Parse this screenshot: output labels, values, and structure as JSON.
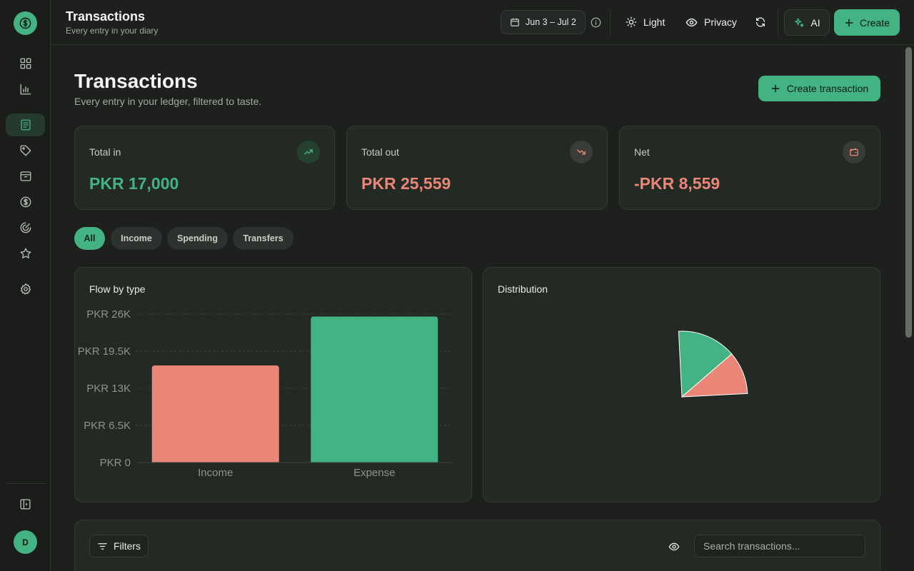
{
  "colors": {
    "accent": "#43b383",
    "income": "#43b383",
    "expense": "#ea8677",
    "bar_income": "#ea8677",
    "bar_expense": "#43b383"
  },
  "sidebar": {
    "logo_icon": "dollar-icon",
    "items": [
      {
        "name": "dashboard",
        "icon": "grid-icon",
        "active": false
      },
      {
        "name": "reports",
        "icon": "bar-chart-icon",
        "active": false
      },
      {
        "name": "transactions",
        "icon": "receipt-icon",
        "active": true
      },
      {
        "name": "categories",
        "icon": "tag-icon",
        "active": false
      },
      {
        "name": "accounts",
        "icon": "inbox-icon",
        "active": false
      },
      {
        "name": "budgets",
        "icon": "dollar-circle-icon",
        "active": false
      },
      {
        "name": "goals",
        "icon": "target-icon",
        "active": false
      },
      {
        "name": "favorites",
        "icon": "star-icon",
        "active": false
      },
      {
        "name": "settings",
        "icon": "gear-icon",
        "active": false
      }
    ],
    "avatar_initial": "D"
  },
  "topbar": {
    "title": "Transactions",
    "subtitle": "Every entry in your diary",
    "date_range": "Jun 3 – Jul 2",
    "theme_label": "Light",
    "privacy_label": "Privacy",
    "ai_label": "AI",
    "create_label": "Create"
  },
  "page": {
    "title": "Transactions",
    "subtitle": "Every entry in your ledger, filtered to taste.",
    "create_button": "Create transaction"
  },
  "stats": {
    "total_in": {
      "label": "Total in",
      "value": "PKR 17,000"
    },
    "total_out": {
      "label": "Total out",
      "value": "PKR 25,559"
    },
    "net": {
      "label": "Net",
      "value": "-PKR 8,559"
    }
  },
  "filters": {
    "tabs": [
      "All",
      "Income",
      "Spending",
      "Transfers"
    ],
    "active": "All"
  },
  "flow_card": {
    "title": "Flow by type"
  },
  "distribution_card": {
    "title": "Distribution"
  },
  "table_toolbar": {
    "filters_label": "Filters",
    "search_placeholder": "Search transactions..."
  },
  "chart_data": [
    {
      "type": "bar",
      "title": "Flow by type",
      "categories": [
        "Income",
        "Expense"
      ],
      "values": [
        17000,
        25559
      ],
      "ylim": [
        0,
        26000
      ],
      "yticks": [
        "PKR 0",
        "PKR 6.5K",
        "PKR 13K",
        "PKR 19.5K",
        "PKR 26K"
      ],
      "ytick_values": [
        0,
        6500,
        13000,
        19500,
        26000
      ],
      "grid": true
    },
    {
      "type": "pie",
      "title": "Distribution",
      "slices": [
        {
          "label": "Income",
          "value": 17000
        },
        {
          "label": "Expense",
          "value": 25559
        }
      ]
    }
  ]
}
